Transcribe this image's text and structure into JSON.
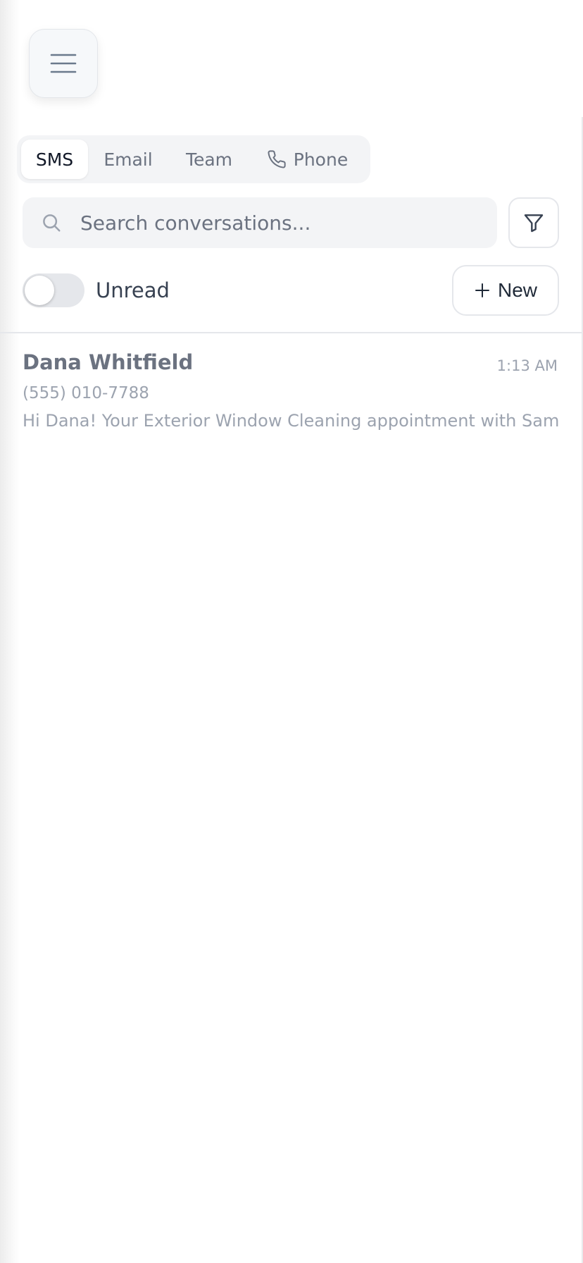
{
  "header": {
    "menu_icon": "hamburger-menu-icon"
  },
  "tabs": [
    {
      "label": "SMS",
      "active": true
    },
    {
      "label": "Email",
      "active": false
    },
    {
      "label": "Team",
      "active": false
    },
    {
      "label": "Phone",
      "active": false,
      "icon": "phone-icon"
    }
  ],
  "search": {
    "placeholder": "Search conversations...",
    "value": "",
    "icon": "search-icon"
  },
  "filter": {
    "icon": "filter-icon"
  },
  "unread_toggle": {
    "label": "Unread",
    "checked": false
  },
  "new_button": {
    "label": "New",
    "icon": "plus-icon"
  },
  "conversations": [
    {
      "name": "Dana Whitfield",
      "time": "1:13 AM",
      "phone": "(555) 010-7788",
      "preview": "Hi Dana! Your Exterior Window Cleaning appointment with Samp"
    }
  ],
  "colors": {
    "background": "#ffffff",
    "tab_bar": "#f3f4f6",
    "muted_text": "#9ca3af",
    "primary_text": "#374151",
    "border": "#e5e7eb"
  }
}
